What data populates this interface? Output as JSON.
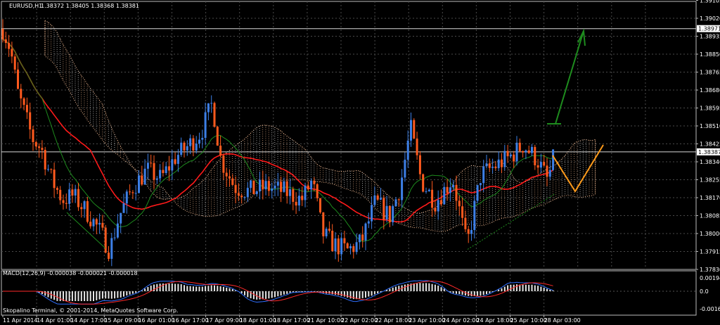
{
  "window": {
    "symbol_label": "EURUSD,H1",
    "ohlc_label": "1.38372 1.38405 1.38368 1.38381"
  },
  "colors": {
    "background": "#000000",
    "grid": "#4a4a4a",
    "bull_candle": "#3d7fe6",
    "bear_candle": "#ff5a1e",
    "ma_slow": "#ff1a1a",
    "ma_fast": "#1e8c1e",
    "cloud_a": "#f0b890",
    "cloud_b": "#e6e6e6",
    "arrow_green": "#1e8c1e",
    "zigzag_orange": "#ff9a1a",
    "macd_hist": "#e6e6e6",
    "macd_line": "#2f6fff",
    "signal_line": "#ff2a2a"
  },
  "indicator": {
    "macd_label": "MACD(12,26,9) -0.000038 -0.000021 -0.000018",
    "copyright": "Skopalino Terminal, © 2001-2014, MetaQuotes Software Corp."
  },
  "chart_data": {
    "type": "candlestick",
    "symbol": "EURUSD",
    "timeframe": "H1",
    "price_range": [
      1.3783,
      1.391
    ],
    "y_ticks": [
      "1.39105",
      "1.39020",
      "1.38935",
      "1.38850",
      "1.38765",
      "1.38680",
      "1.38595",
      "1.38510",
      "1.38425",
      "1.38340",
      "1.38255",
      "1.38170",
      "1.38085",
      "1.38000",
      "1.37915",
      "1.37830"
    ],
    "x_ticks": [
      "11 Apr 2014",
      "14 Apr 01:00",
      "14 Apr 17:00",
      "15 Apr 09:00",
      "16 Apr 01:00",
      "16 Apr 17:00",
      "17 Apr 09:00",
      "18 Apr 01:00",
      "18 Apr 17:00",
      "21 Apr 10:00",
      "22 Apr 02:00",
      "22 Apr 18:00",
      "23 Apr 10:00",
      "24 Apr 02:00",
      "24 Apr 18:00",
      "25 Apr 10:00",
      "28 Apr 03:00"
    ],
    "horizontal_lines": [
      {
        "price": 1.38971,
        "label": "1.38971"
      },
      {
        "price": 1.38387,
        "label": "1.38387"
      }
    ],
    "current_price": 1.38381,
    "grid": true,
    "macd": {
      "params": "12,26,9",
      "values": [
        -3.8e-05,
        -2.1e-05,
        -1.8e-05
      ],
      "y_ticks": [
        "0.00194",
        "0.0",
        "-0.00164"
      ]
    }
  }
}
